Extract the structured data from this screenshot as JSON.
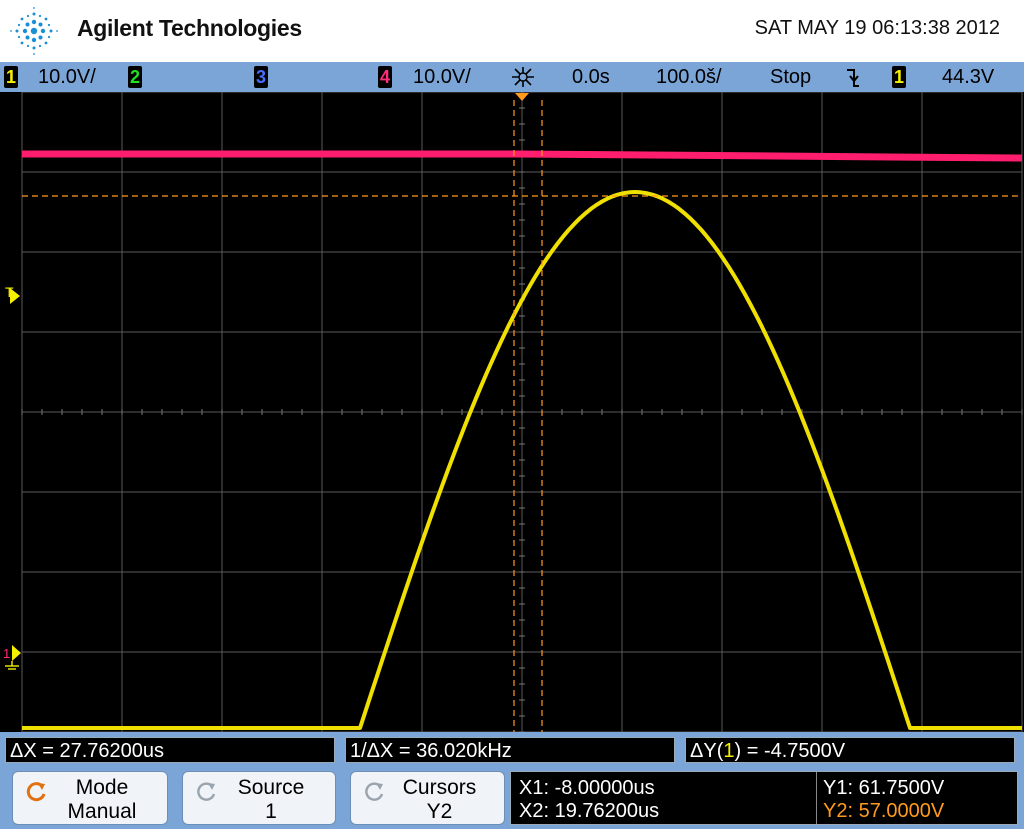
{
  "header": {
    "brand": "Agilent Technologies",
    "datetime": "SAT MAY 19 06:13:38 2012"
  },
  "status_bar": {
    "ch1_num": "1",
    "ch1_scale": "10.0V/",
    "ch2_num": "2",
    "ch3_num": "3",
    "ch4_num": "4",
    "ch4_scale": "10.0V/",
    "time_delay": "0.0s",
    "time_scale": "100.0š/",
    "run_state": "Stop",
    "trigger_source": "1",
    "trigger_level": "44.3V",
    "colors": {
      "ch1": "#f5f000",
      "ch2": "#22e022",
      "ch3": "#4b6cff",
      "ch4": "#ff2d7a"
    }
  },
  "display": {
    "trigger_marker": "T",
    "ground_marker": "1",
    "colors": {
      "ch1_trace": "#f0e000",
      "ch4_trace": "#ff1d6e",
      "cursor": "#ff9a1f",
      "grid": "#5a5a5a"
    }
  },
  "cursor_bar": {
    "delta_x": "ΔX = 27.76200us",
    "inv_delta_x": "1/ΔX = 36.020kHz",
    "delta_y_prefix": "ΔY(",
    "delta_y_channel": "1",
    "delta_y_suffix": ") = -4.7500V"
  },
  "softkeys": {
    "mode": {
      "title": "Mode",
      "value": "Manual"
    },
    "source": {
      "title": "Source",
      "value": "1"
    },
    "cursors": {
      "title": "Cursors",
      "value": "Y2"
    },
    "readout": {
      "x1": "X1: -8.00000us",
      "x2": "X2: 19.76200us",
      "y1": "Y1: 61.7500V",
      "y2": "Y2: 57.0000V"
    }
  }
}
